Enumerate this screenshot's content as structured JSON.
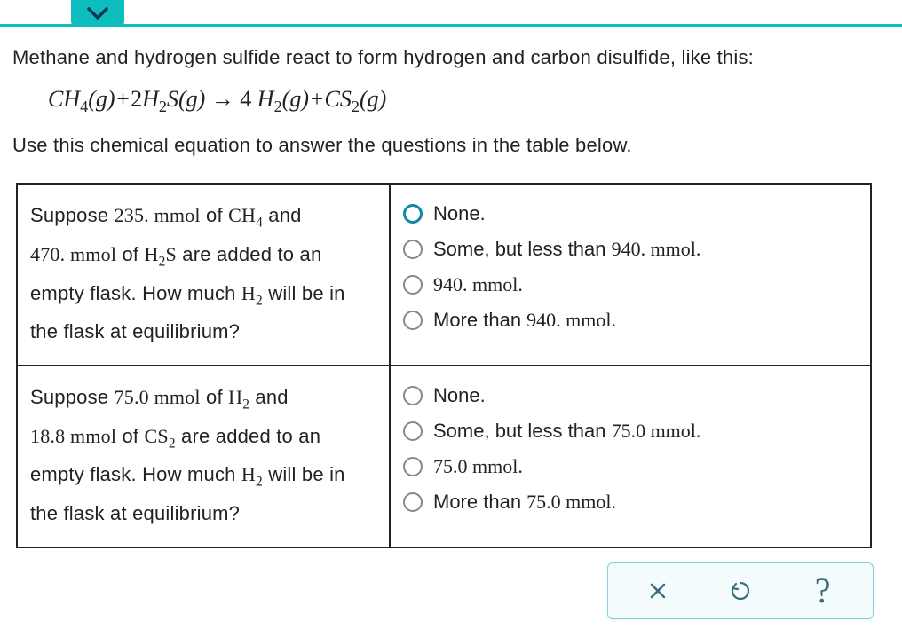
{
  "intro": "Methane and hydrogen sulfide react to form hydrogen and carbon disulfide, like this:",
  "outro": "Use this chemical equation to answer the questions in the table below.",
  "equation": {
    "lhs_a": "CH",
    "lhs_a_sub": "4",
    "lhs_a_state": "(g)",
    "plus1": "+",
    "lhs_b_coef": "2",
    "lhs_b": "H",
    "lhs_b_sub": "2",
    "lhs_b2": "S",
    "lhs_b_state": "(g)",
    "arrow": "→",
    "rhs_a_coef": "4",
    "rhs_a": "H",
    "rhs_a_sub": "2",
    "rhs_a_state": "(g)",
    "plus2": "+",
    "rhs_b": "CS",
    "rhs_b_sub": "2",
    "rhs_b_state": "(g)"
  },
  "q1": {
    "p1a": "Suppose ",
    "p1b": "235. mmol",
    "p1c": " of ",
    "p1d": "CH",
    "p1d_sub": "4",
    "p1e": " and",
    "p2a": "470. mmol",
    "p2b": " of ",
    "p2c": "H",
    "p2c_sub": "2",
    "p2d": "S",
    "p2e": " are added to an",
    "p3a": "empty flask. How much ",
    "p3b": "H",
    "p3b_sub": "2",
    "p3c": " will be in",
    "p4": "the flask at equilibrium?",
    "opts": {
      "a": "None.",
      "b_pre": "Some, but less than ",
      "b_val": "940. mmol.",
      "c": "940. mmol.",
      "d_pre": "More than ",
      "d_val": "940. mmol."
    },
    "selected": "a"
  },
  "q2": {
    "p1a": "Suppose ",
    "p1b": "75.0 mmol",
    "p1c": " of ",
    "p1d": "H",
    "p1d_sub": "2",
    "p1e": " and",
    "p2a": "18.8 mmol",
    "p2b": " of ",
    "p2c": "CS",
    "p2c_sub": "2",
    "p2e": " are added to an",
    "p3a": "empty flask. How much ",
    "p3b": "H",
    "p3b_sub": "2",
    "p3c": " will be in",
    "p4": "the flask at equilibrium?",
    "opts": {
      "a": "None.",
      "b_pre": "Some, but less than ",
      "b_val": "75.0 mmol.",
      "c": "75.0 mmol.",
      "d_pre": "More than ",
      "d_val": "75.0 mmol."
    }
  },
  "toolbar": {
    "close": "×",
    "undo": "↺",
    "help": "?"
  }
}
